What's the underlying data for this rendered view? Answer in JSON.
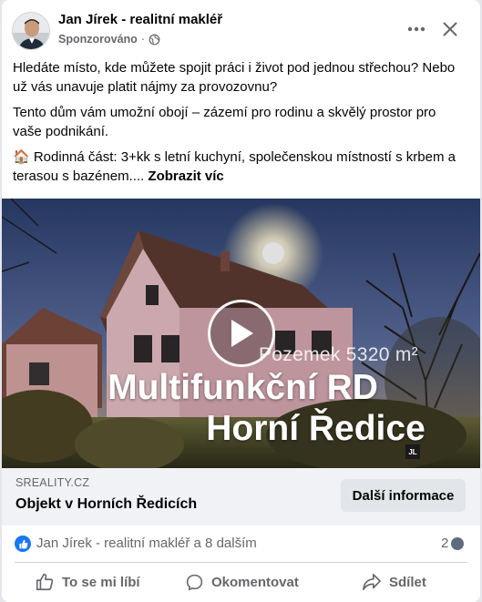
{
  "post": {
    "author": "Jan Jírek - realitní makléř",
    "sponsored_label": "Sponzorováno",
    "separator": "·",
    "paragraphs": [
      "Hledáte místo, kde můžete spojit práci i život pod jednou střechou? Nebo už vás unavuje platit nájmy za provozovnu?",
      "Tento dům vám umožní obojí – zázemí pro rodinu a skvělý prostor pro vaše podnikání."
    ],
    "third_paragraph": "🏠 Rodinná část: 3+kk s letní kuchyní, společenskou místností s krbem a terasou s bazénem.... ",
    "see_more": "Zobrazit víc"
  },
  "header": {
    "more_icon": "more-horizontal-icon",
    "close_icon": "close-icon",
    "privacy_icon": "globe-icon"
  },
  "media": {
    "land_text": "Pozemek 5320 m²",
    "title_line1": "Multifunkční RD",
    "title_line2": "Horní Ředice",
    "logo_text": "JL",
    "play_icon": "play-icon"
  },
  "link": {
    "domain": "SREALITY.CZ",
    "title": "Objekt v Horních Ředicích",
    "cta": "Další informace"
  },
  "reactions": {
    "summary": "Jan Jírek - realitní makléř a 8 dalším",
    "comments": "2",
    "like_icon": "thumbs-up-icon"
  },
  "actions": {
    "like": "To se mi líbí",
    "comment": "Okomentovat",
    "share": "Sdílet"
  },
  "colors": {
    "brand_blue": "#1877f2",
    "secondary_text": "#65676b",
    "strip_bg": "#f0f2f5"
  }
}
